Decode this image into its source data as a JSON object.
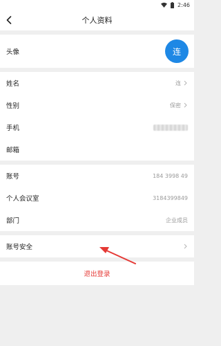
{
  "status_bar": {
    "time": "2:46"
  },
  "nav": {
    "title": "个人资料"
  },
  "profile": {
    "avatar_label": "头像",
    "avatar_text": "连"
  },
  "personal": {
    "name_label": "姓名",
    "name_value": "连",
    "gender_label": "性别",
    "gender_value": "保密",
    "phone_label": "手机",
    "email_label": "邮箱"
  },
  "account": {
    "account_label": "账号",
    "account_value": "184 3998 49",
    "meeting_room_label": "个人会议室",
    "meeting_room_value": "3184399849",
    "department_label": "部门",
    "department_value": "企业成员"
  },
  "security": {
    "label": "账号安全"
  },
  "logout_label": "退出登录",
  "colors": {
    "accent": "#1e88e5",
    "logout": "#e53935",
    "annotation_arrow": "#e53935"
  },
  "icons": {
    "back": "back-arrow-icon",
    "wifi": "wifi-icon",
    "battery": "battery-icon",
    "chevron": "chevron-right-icon"
  }
}
